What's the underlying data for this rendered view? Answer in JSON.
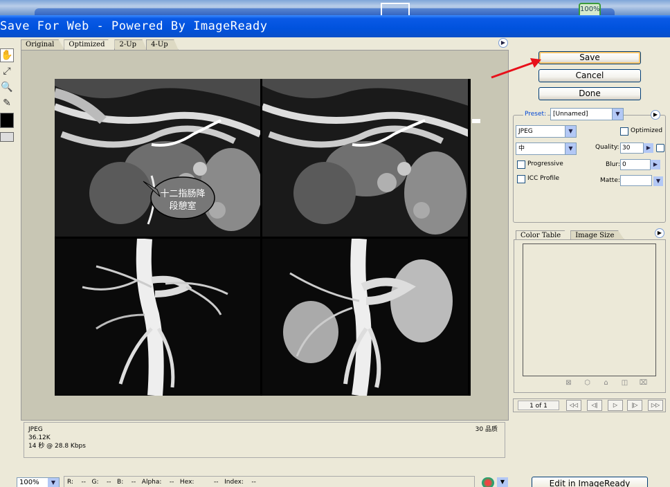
{
  "window": {
    "title": "Save For Web - Powered By ImageReady",
    "taskbar_zoom": "100%"
  },
  "view_tabs": [
    "Original",
    "Optimized",
    "2-Up",
    "4-Up"
  ],
  "active_view_tab": "Optimized",
  "image": {
    "annotation_line1": "十二指肠降",
    "annotation_line2": "段憩室"
  },
  "info_bar": {
    "format": "JPEG",
    "size": "36.12K",
    "speed": "14 秒 @ 28.8 Kbps",
    "quality_note": "30 品质"
  },
  "status": {
    "zoom": "100%",
    "readout": "R:    --   G:    --   B:    --   Alpha:    --   Hex:          --   Index:    --"
  },
  "buttons": {
    "save": "Save",
    "cancel": "Cancel",
    "done": "Done",
    "edit_imageready": "Edit in ImageReady"
  },
  "settings": {
    "preset_label": "Preset:",
    "preset_value": "[Unnamed]",
    "format": "JPEG",
    "quality_level": "中",
    "optimized_label": "Optimized",
    "progressive_label": "Progressive",
    "icc_label": "ICC Profile",
    "quality_label": "Quality:",
    "quality_value": "30",
    "blur_label": "Blur:",
    "blur_value": "0",
    "matte_label": "Matte:"
  },
  "color_table": {
    "tabs": [
      "Color Table",
      "Image Size"
    ],
    "active_tab": "Color Table"
  },
  "animation": {
    "frame_count": "1 of 1"
  },
  "icons": {
    "hand": "hand-tool-icon",
    "slice_select": "slice-select-icon",
    "zoom": "zoom-tool-icon",
    "eyedropper": "eyedropper-icon",
    "menu": "panel-menu-icon"
  },
  "colors": {
    "title_bar": "#0052dd",
    "arrow": "#e8101a",
    "preset_label": "#0046d5"
  }
}
